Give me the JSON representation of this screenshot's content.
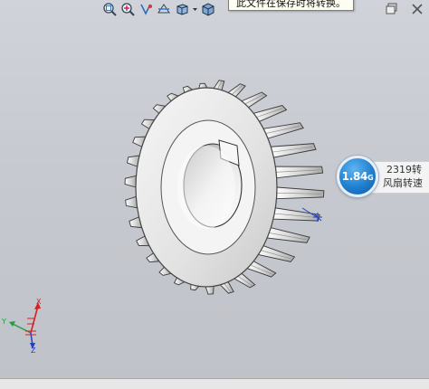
{
  "toolbar": {
    "buttons": [
      {
        "icon": "zoom-to-fit-icon"
      },
      {
        "icon": "zoom-to-area-icon"
      },
      {
        "icon": "previous-view-icon"
      },
      {
        "icon": "section-view-icon"
      },
      {
        "icon": "view-orientation-icon"
      },
      {
        "icon": "display-style-icon"
      }
    ]
  },
  "tooltip": {
    "text": "此文件在保存时将转换。"
  },
  "speed": {
    "value": "1.84",
    "unit": "G",
    "rpm": "2319转",
    "label": "风扇转速"
  },
  "triad": {
    "x": "X",
    "y": "Y",
    "z": "Z"
  },
  "colors": {
    "speed_circle": "#1f7fd0",
    "triad_red": "#d92020",
    "triad_blue": "#1f3fd0",
    "triad_green": "#20a040"
  }
}
